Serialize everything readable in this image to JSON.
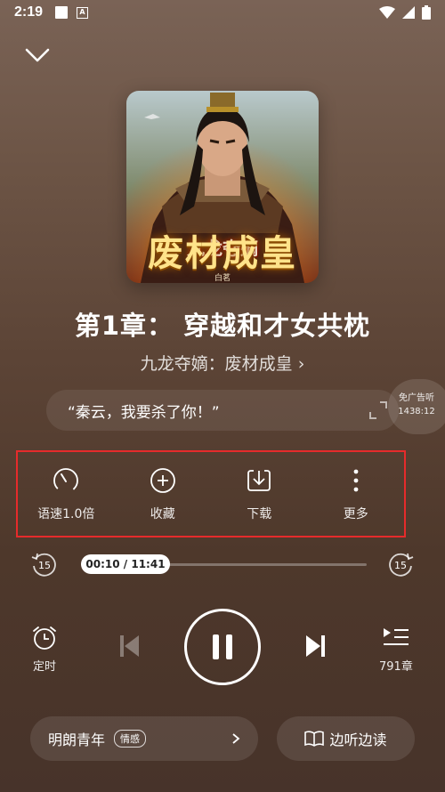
{
  "status_bar": {
    "time": "2:19"
  },
  "cover": {
    "subtitle": "九龙夺嫡",
    "title": "废材成皇",
    "author": "白茗"
  },
  "chapter": {
    "title": "第1章： 穿越和才女共枕"
  },
  "book": {
    "name": "九龙夺嫡：废材成皇 ›"
  },
  "quote": {
    "text": "“秦云，我要杀了你！”"
  },
  "ad_free": {
    "label": "免广告听",
    "countdown": "1438:12"
  },
  "actions": {
    "speed": "语速1.0倍",
    "favorite": "收藏",
    "download": "下载",
    "more": "更多"
  },
  "progress": {
    "time_label": "00:10 / 11:41",
    "played_fraction": 0.014,
    "skip_back": "15",
    "skip_forward": "15"
  },
  "player": {
    "timer_label": "定时",
    "chapters_label": "791章"
  },
  "bottom": {
    "voice_name": "明朗青年",
    "voice_tag": "情感",
    "read_label": "边听边读"
  }
}
